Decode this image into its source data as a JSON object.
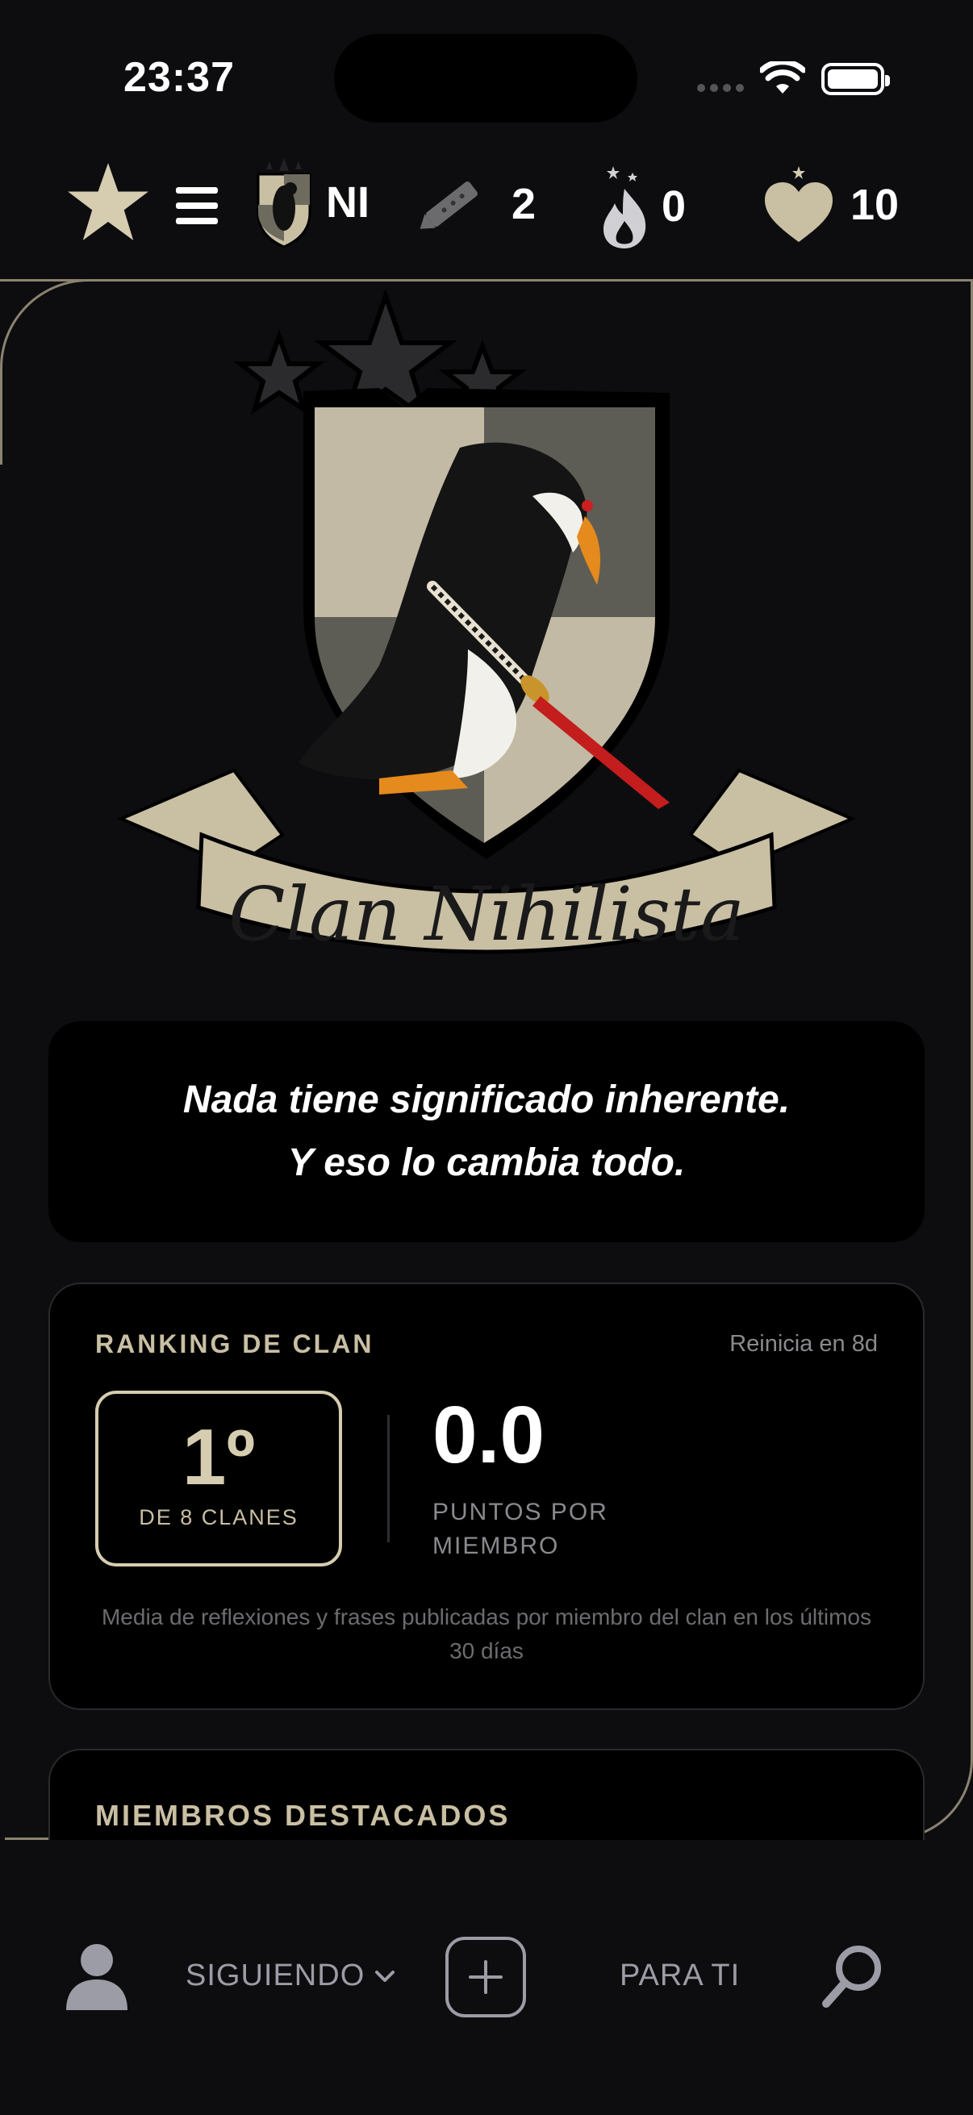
{
  "status": {
    "time": "23:37"
  },
  "topbar": {
    "clan_tag": "NI",
    "quills_count": "2",
    "streak_count": "0",
    "hearts_count": "10"
  },
  "crest": {
    "banner_text": "Clan Nihilista"
  },
  "motto": {
    "line1": "Nada tiene significado inherente.",
    "line2": "Y eso lo cambia todo."
  },
  "ranking": {
    "title": "RANKING DE CLAN",
    "reset": "Reinicia en 8d",
    "position": "1º",
    "of_clans": "DE 8 CLANES",
    "score": "0.0",
    "score_label": "PUNTOS POR MIEMBRO",
    "note": "Media de reflexiones y frases publicadas por miembro del clan en los últimos 30 días"
  },
  "featured": {
    "title": "MIEMBROS DESTACADOS"
  },
  "nav": {
    "following": "SIGUIENDO",
    "for_you": "PARA TI"
  },
  "colors": {
    "accent": "#d6ccb0",
    "background": "#0d0d10",
    "card": "#000000",
    "muted": "#8a8a8e"
  }
}
